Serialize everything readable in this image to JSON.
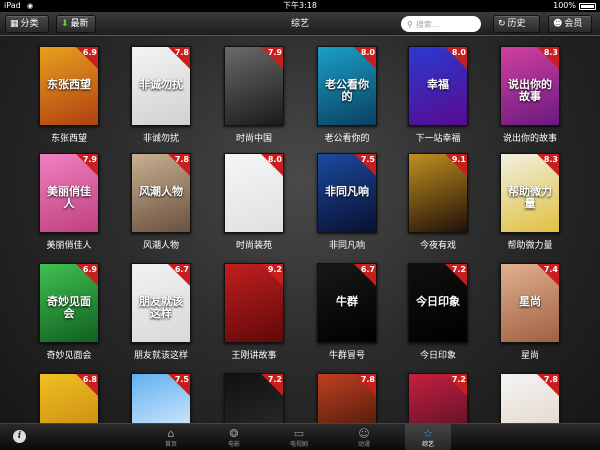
{
  "status_bar": {
    "carrier": "iPad",
    "time": "下午3:18",
    "battery": "100%"
  },
  "nav": {
    "category_label": "分类",
    "latest_label": "最新",
    "title": "综艺",
    "search_placeholder": "搜索...",
    "history_label": "历史",
    "member_label": "会员"
  },
  "shows": [
    {
      "title": "东张西望",
      "rating": "6.9",
      "art": "东张西望",
      "bg": "#e8a020",
      "bg2": "#b04010"
    },
    {
      "title": "非诚勿扰",
      "rating": "7.8",
      "art": "非诚勿扰",
      "bg": "#f4f4f4",
      "bg2": "#d0d0d0"
    },
    {
      "title": "时尚中国",
      "rating": "7.9",
      "art": "",
      "bg": "#6a6a6a",
      "bg2": "#1a1a1a"
    },
    {
      "title": "老公看你的",
      "rating": "8.0",
      "art": "老公看你的",
      "bg": "#1aa0c8",
      "bg2": "#0a4060"
    },
    {
      "title": "下一站幸福",
      "rating": "8.0",
      "art": "幸福",
      "bg": "#2a3ad0",
      "bg2": "#5a0a90"
    },
    {
      "title": "说出你的故事",
      "rating": "8.3",
      "art": "说出你的故事",
      "bg": "#d040a0",
      "bg2": "#6a1a80"
    },
    {
      "title": "美丽俏佳人",
      "rating": "7.9",
      "art": "美丽俏佳人",
      "bg": "#f080c0",
      "bg2": "#c04080"
    },
    {
      "title": "风潮人物",
      "rating": "7.8",
      "art": "风潮人物",
      "bg": "#c8b090",
      "bg2": "#6a5040"
    },
    {
      "title": "时尚装苑",
      "rating": "8.0",
      "art": "",
      "bg": "#f6f6f6",
      "bg2": "#e0e0e0"
    },
    {
      "title": "非同凡响",
      "rating": "7.5",
      "art": "非同凡响",
      "bg": "#1a4aa0",
      "bg2": "#0a1030"
    },
    {
      "title": "今夜有戏",
      "rating": "9.1",
      "art": "",
      "bg": "#c09020",
      "bg2": "#201008"
    },
    {
      "title": "帮助微力量",
      "rating": "8.3",
      "art": "帮助微力量",
      "bg": "#f0f0e0",
      "bg2": "#e0c040"
    },
    {
      "title": "奇妙见面会",
      "rating": "6.9",
      "art": "奇妙见面会",
      "bg": "#40c050",
      "bg2": "#106020"
    },
    {
      "title": "朋友就该这样",
      "rating": "6.7",
      "art": "朋友就该这样",
      "bg": "#f2f2f2",
      "bg2": "#d8d8d8"
    },
    {
      "title": "王刚讲故事",
      "rating": "9.2",
      "art": "",
      "bg": "#c02020",
      "bg2": "#600808"
    },
    {
      "title": "牛群冒号",
      "rating": "6.7",
      "art": "牛群",
      "bg": "#181818",
      "bg2": "#000000"
    },
    {
      "title": "今日印象",
      "rating": "7.2",
      "art": "今日印象",
      "bg": "#101010",
      "bg2": "#000000"
    },
    {
      "title": "星尚",
      "rating": "7.4",
      "art": "星尚",
      "bg": "#e0b090",
      "bg2": "#a06040"
    },
    {
      "title": "",
      "rating": "6.8",
      "art": "",
      "bg": "#f0c020",
      "bg2": "#c08010"
    },
    {
      "title": "",
      "rating": "7.5",
      "art": "",
      "bg": "#60b0f0",
      "bg2": "#f0f8ff"
    },
    {
      "title": "",
      "rating": "7.2",
      "art": "",
      "bg": "#101010",
      "bg2": "#303030"
    },
    {
      "title": "",
      "rating": "7.8",
      "art": "",
      "bg": "#c04020",
      "bg2": "#301008"
    },
    {
      "title": "",
      "rating": "7.2",
      "art": "",
      "bg": "#c81e40",
      "bg2": "#401020"
    },
    {
      "title": "",
      "rating": "7.8",
      "art": "",
      "bg": "#f4f4f4",
      "bg2": "#e0d0c0"
    }
  ],
  "tabbar": {
    "tabs": [
      {
        "label": "首页",
        "icon": "home-icon"
      },
      {
        "label": "电影",
        "icon": "film-reel-icon"
      },
      {
        "label": "电视剧",
        "icon": "tv-icon"
      },
      {
        "label": "动漫",
        "icon": "anime-face-icon"
      },
      {
        "label": "综艺",
        "icon": "star-icon"
      }
    ],
    "active": "综艺"
  }
}
